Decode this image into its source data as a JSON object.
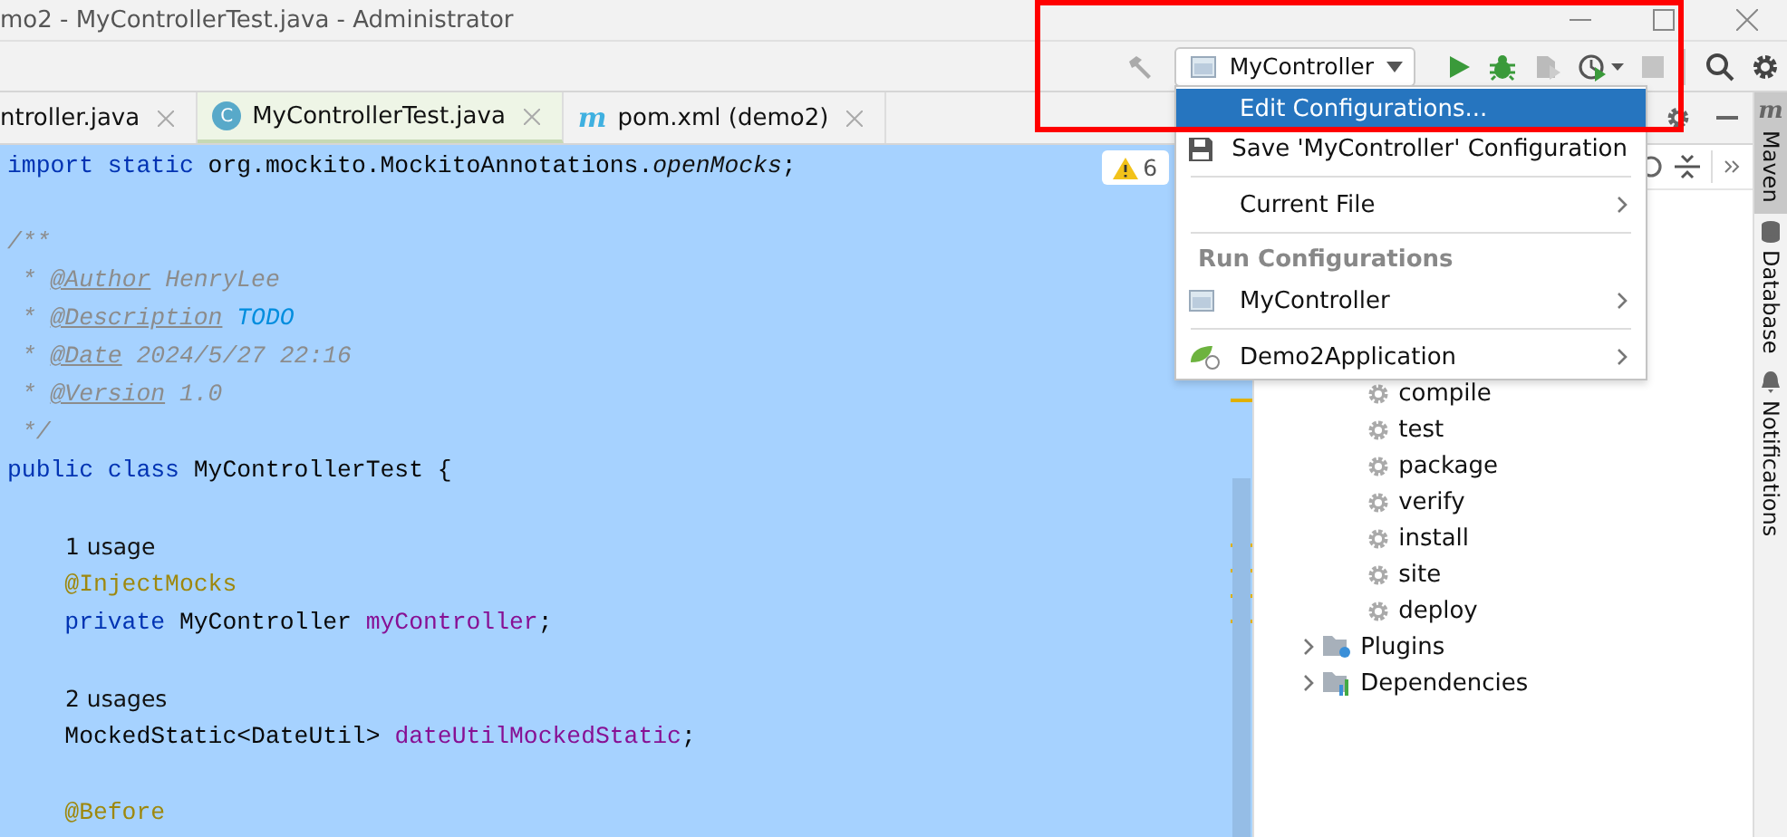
{
  "window": {
    "title": "mo2 - MyControllerTest.java - Administrator"
  },
  "toolbar": {
    "run_config": "MyController",
    "actions": [
      {
        "kind": "build",
        "disabled": true
      },
      {
        "kind": "run",
        "disabled": false
      },
      {
        "kind": "debug",
        "disabled": false
      },
      {
        "kind": "coverage",
        "disabled": true
      },
      {
        "kind": "profile",
        "disabled": false
      },
      {
        "kind": "stop",
        "disabled": true
      },
      {
        "kind": "search",
        "disabled": false
      },
      {
        "kind": "settings",
        "disabled": false
      }
    ]
  },
  "tabs": [
    {
      "label": "ntroller.java",
      "selected": false,
      "kind": "plain"
    },
    {
      "label": "MyControllerTest.java",
      "selected": true,
      "kind": "class",
      "icon_text": "C"
    },
    {
      "label": "pom.xml (demo2)",
      "selected": false,
      "kind": "maven",
      "icon_text": "m"
    }
  ],
  "editor": {
    "warnings": "6",
    "lines": [
      {
        "kind": "code",
        "tokens": [
          {
            "text": "import static",
            "kind": "keyword"
          },
          {
            "text": " org.mockito.MockitoAnnotations.",
            "kind": "plain"
          },
          {
            "text": "openMocks",
            "kind": "static"
          },
          {
            "text": ";",
            "kind": "plain"
          }
        ]
      },
      {
        "kind": "blank"
      },
      {
        "kind": "code",
        "tokens": [
          {
            "text": "/**",
            "kind": "doc"
          }
        ]
      },
      {
        "kind": "code",
        "tokens": [
          {
            "text": " * ",
            "kind": "doc"
          },
          {
            "text": "@Author",
            "kind": "doctag"
          },
          {
            "text": " HenryLee",
            "kind": "doc"
          }
        ]
      },
      {
        "kind": "code",
        "tokens": [
          {
            "text": " * ",
            "kind": "doc"
          },
          {
            "text": "@Description",
            "kind": "doctag"
          },
          {
            "text": " TODO",
            "kind": "todo"
          }
        ]
      },
      {
        "kind": "code",
        "tokens": [
          {
            "text": " * ",
            "kind": "doc"
          },
          {
            "text": "@Date",
            "kind": "doctag"
          },
          {
            "text": " 2024/5/27 22:16",
            "kind": "doc"
          }
        ]
      },
      {
        "kind": "code",
        "tokens": [
          {
            "text": " * ",
            "kind": "doc"
          },
          {
            "text": "@Version",
            "kind": "doctag"
          },
          {
            "text": " 1.0",
            "kind": "doc"
          }
        ]
      },
      {
        "kind": "code",
        "tokens": [
          {
            "text": " */",
            "kind": "doc"
          }
        ]
      },
      {
        "kind": "code",
        "tokens": [
          {
            "text": "public class",
            "kind": "keyword"
          },
          {
            "text": " MyControllerTest {",
            "kind": "plain"
          }
        ]
      },
      {
        "kind": "blank"
      },
      {
        "kind": "hint",
        "tokens": [
          {
            "text": "1 usage",
            "kind": "hint"
          }
        ]
      },
      {
        "kind": "code",
        "tokens": [
          {
            "text": "    @InjectMocks",
            "kind": "annotation"
          }
        ]
      },
      {
        "kind": "code",
        "tokens": [
          {
            "text": "    private",
            "kind": "keyword"
          },
          {
            "text": " MyController ",
            "kind": "plain"
          },
          {
            "text": "myController",
            "kind": "field"
          },
          {
            "text": ";",
            "kind": "plain"
          }
        ]
      },
      {
        "kind": "blank"
      },
      {
        "kind": "hint",
        "tokens": [
          {
            "text": "2 usages",
            "kind": "hint"
          }
        ]
      },
      {
        "kind": "code",
        "tokens": [
          {
            "text": "    MockedStatic<DateUtil> ",
            "kind": "plain"
          },
          {
            "text": "dateUtilMockedStatic",
            "kind": "field"
          },
          {
            "text": ";",
            "kind": "plain"
          }
        ]
      },
      {
        "kind": "blank"
      },
      {
        "kind": "code",
        "tokens": [
          {
            "text": "    @Before",
            "kind": "annotation"
          }
        ]
      }
    ]
  },
  "menu": {
    "items": [
      {
        "kind": "item",
        "label": "Edit Configurations...",
        "selected": true,
        "submenu": false
      },
      {
        "kind": "save",
        "label": "Save 'MyController' Configuration",
        "selected": false,
        "submenu": false
      },
      {
        "kind": "separator"
      },
      {
        "kind": "item",
        "label": "Current File",
        "selected": false,
        "submenu": true
      },
      {
        "kind": "separator"
      },
      {
        "kind": "header",
        "label": "Run Configurations"
      },
      {
        "kind": "run_config",
        "label": "MyController",
        "selected": false,
        "submenu": true
      },
      {
        "kind": "separator"
      },
      {
        "kind": "spring",
        "label": "Demo2Application",
        "selected": false,
        "submenu": true
      }
    ]
  },
  "maven": {
    "tree": [
      {
        "label": "compile",
        "kind": "goal"
      },
      {
        "label": "test",
        "kind": "goal"
      },
      {
        "label": "package",
        "kind": "goal"
      },
      {
        "label": "verify",
        "kind": "goal"
      },
      {
        "label": "install",
        "kind": "goal"
      },
      {
        "label": "site",
        "kind": "goal"
      },
      {
        "label": "deploy",
        "kind": "goal"
      },
      {
        "label": "Plugins",
        "kind": "plugins",
        "expanded": false
      },
      {
        "label": "Dependencies",
        "kind": "dependencies",
        "expanded": false
      }
    ]
  },
  "side_tabs": [
    {
      "label": "Maven",
      "selected": true,
      "kind": "maven",
      "icon_text": "m"
    },
    {
      "label": "Database",
      "selected": false,
      "kind": "database"
    },
    {
      "label": "Notifications",
      "selected": false,
      "kind": "bell"
    }
  ]
}
